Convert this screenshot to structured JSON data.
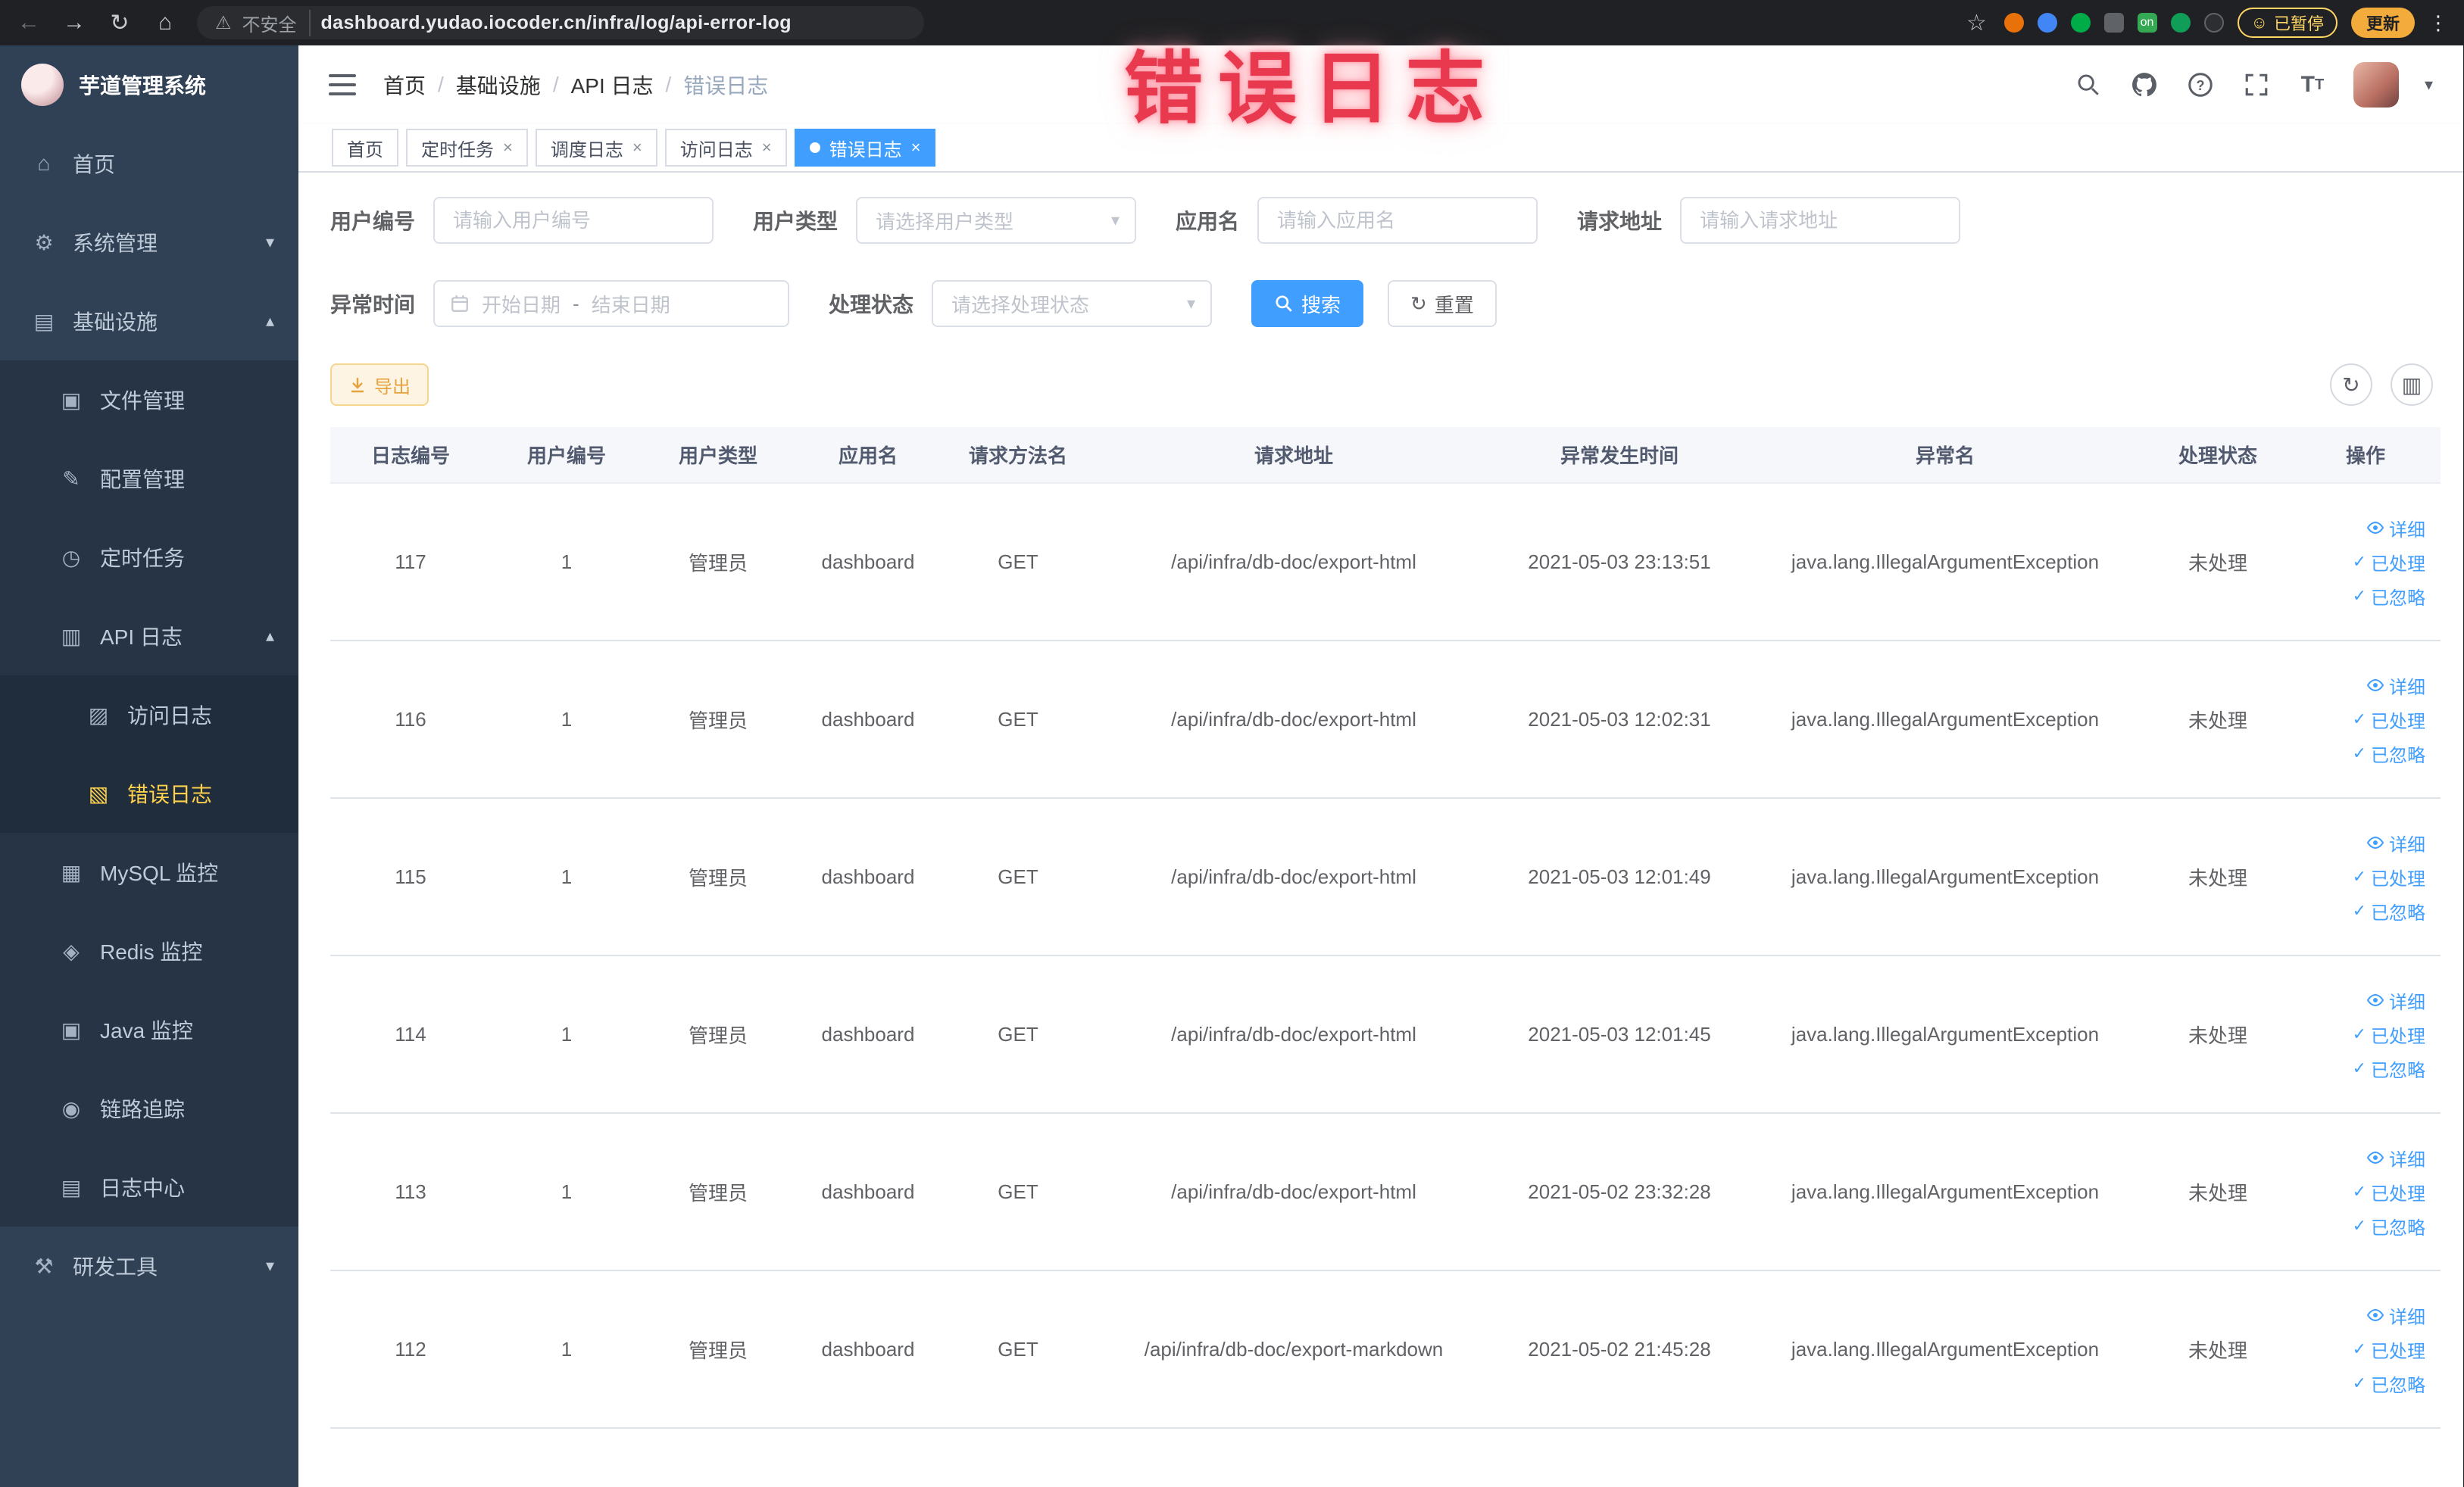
{
  "colors": {
    "primary": "#409eff",
    "sidebar_bg": "#304156",
    "sidebar_active": "#ffd04b",
    "warning": "#e6a23c",
    "annotation_red": "#e8394f",
    "tab_active_bg": "#409eff"
  },
  "icons": {
    "back": "←",
    "forward": "→",
    "reload": "↻",
    "home": "⌂",
    "warning": "⚠",
    "star": "☆",
    "smiley": "☺",
    "menu_dots": "⋮",
    "caret": "▾",
    "check": "✓",
    "refresh": "↻",
    "columns": "▥"
  },
  "browser": {
    "security_label": "不安全",
    "url": "dashboard.yudao.iocoder.cn/infra/log/api-error-log",
    "paused_chip": "已暂停",
    "update_button": "更新",
    "ext_on_badge": "on"
  },
  "annotation": "错误日志",
  "sidebar": {
    "title": "芋道管理系统",
    "items": [
      {
        "label": "首页",
        "glyph": "⌂"
      },
      {
        "label": "系统管理",
        "glyph": "⚙",
        "chevron": "▾"
      },
      {
        "label": "基础设施",
        "glyph": "▤",
        "chevron": "▴"
      },
      {
        "label": "文件管理",
        "glyph": "▣"
      },
      {
        "label": "配置管理",
        "glyph": "✎"
      },
      {
        "label": "定时任务",
        "glyph": "◷"
      },
      {
        "label": "API 日志",
        "glyph": "▥",
        "chevron": "▴"
      },
      {
        "label": "访问日志",
        "glyph": "▨"
      },
      {
        "label": "错误日志",
        "glyph": "▧"
      },
      {
        "label": "MySQL 监控",
        "glyph": "▦"
      },
      {
        "label": "Redis 监控",
        "glyph": "◈"
      },
      {
        "label": "Java 监控",
        "glyph": "▣"
      },
      {
        "label": "链路追踪",
        "glyph": "◉"
      },
      {
        "label": "日志中心",
        "glyph": "▤"
      },
      {
        "label": "研发工具",
        "glyph": "⚒",
        "chevron": "▾"
      }
    ]
  },
  "breadcrumb": {
    "separator": "/",
    "items": [
      "首页",
      "基础设施",
      "API 日志",
      "错误日志"
    ]
  },
  "tabs": [
    {
      "label": "首页"
    },
    {
      "label": "定时任务",
      "close": "×"
    },
    {
      "label": "调度日志",
      "close": "×"
    },
    {
      "label": "访问日志",
      "close": "×"
    },
    {
      "label": "错误日志",
      "close": "×"
    }
  ],
  "filters": {
    "user_id": {
      "label": "用户编号",
      "placeholder": "请输入用户编号"
    },
    "user_type": {
      "label": "用户类型",
      "placeholder": "请选择用户类型"
    },
    "app_name": {
      "label": "应用名",
      "placeholder": "请输入应用名"
    },
    "request_url": {
      "label": "请求地址",
      "placeholder": "请输入请求地址"
    },
    "exception_time": {
      "label": "异常时间",
      "start_placeholder": "开始日期",
      "separator": "-",
      "end_placeholder": "结束日期"
    },
    "process_status": {
      "label": "处理状态",
      "placeholder": "请选择处理状态"
    },
    "search": "搜索",
    "reset": "重置"
  },
  "toolbar": {
    "export": "导出"
  },
  "table": {
    "columns": [
      "日志编号",
      "用户编号",
      "用户类型",
      "应用名",
      "请求方法名",
      "请求地址",
      "异常发生时间",
      "异常名",
      "处理状态",
      "操作"
    ],
    "actions": {
      "detail": "详细",
      "done": "已处理",
      "ignore": "已忽略"
    },
    "rows": [
      {
        "id": "117",
        "user_id": "1",
        "user_type": "管理员",
        "app": "dashboard",
        "method": "GET",
        "url": "/api/infra/db-doc/export-html",
        "time": "2021-05-03 23:13:51",
        "exception": "java.lang.IllegalArgumentException",
        "status": "未处理"
      },
      {
        "id": "116",
        "user_id": "1",
        "user_type": "管理员",
        "app": "dashboard",
        "method": "GET",
        "url": "/api/infra/db-doc/export-html",
        "time": "2021-05-03 12:02:31",
        "exception": "java.lang.IllegalArgumentException",
        "status": "未处理"
      },
      {
        "id": "115",
        "user_id": "1",
        "user_type": "管理员",
        "app": "dashboard",
        "method": "GET",
        "url": "/api/infra/db-doc/export-html",
        "time": "2021-05-03 12:01:49",
        "exception": "java.lang.IllegalArgumentException",
        "status": "未处理"
      },
      {
        "id": "114",
        "user_id": "1",
        "user_type": "管理员",
        "app": "dashboard",
        "method": "GET",
        "url": "/api/infra/db-doc/export-html",
        "time": "2021-05-03 12:01:45",
        "exception": "java.lang.IllegalArgumentException",
        "status": "未处理"
      },
      {
        "id": "113",
        "user_id": "1",
        "user_type": "管理员",
        "app": "dashboard",
        "method": "GET",
        "url": "/api/infra/db-doc/export-html",
        "time": "2021-05-02 23:32:28",
        "exception": "java.lang.IllegalArgumentException",
        "status": "未处理"
      },
      {
        "id": "112",
        "user_id": "1",
        "user_type": "管理员",
        "app": "dashboard",
        "method": "GET",
        "url": "/api/infra/db-doc/export-markdown",
        "time": "2021-05-02 21:45:28",
        "exception": "java.lang.IllegalArgumentException",
        "status": "未处理"
      }
    ]
  }
}
